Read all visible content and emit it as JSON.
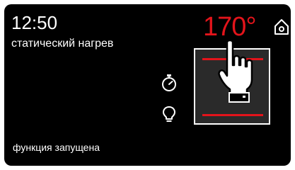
{
  "status_bar": {
    "time": "12:50",
    "mode_label": "статический нагрев"
  },
  "temperature": {
    "value": "170°",
    "color": "#e3141b"
  },
  "footer": {
    "status_text": "функция запущена"
  },
  "icons": {
    "home": "home-icon",
    "timer": "timer-icon",
    "lamp": "lamp-icon",
    "oven_mode": "static-heat-icon",
    "touch_hand": "pointing-hand-icon"
  },
  "colors": {
    "background": "#000000",
    "accent": "#e3141b",
    "text": "#ffffff",
    "oven_fill": "#2a2a2a"
  }
}
